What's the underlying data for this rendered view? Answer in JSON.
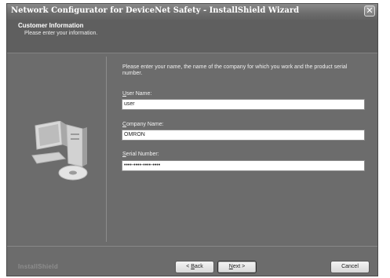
{
  "window": {
    "title": "Network Configurator for DeviceNet Safety - InstallShield Wizard",
    "close_glyph": "✕"
  },
  "header": {
    "title": "Customer Information",
    "subtitle": "Please enter your information."
  },
  "form": {
    "instructions": "Please enter your name, the name of the company for which you work and the product serial number.",
    "user_name": {
      "label_mnemonic": "U",
      "label_rest": "ser Name:",
      "value": "user"
    },
    "company_name": {
      "label_mnemonic": "C",
      "label_rest": "ompany Name:",
      "value": "OMRON"
    },
    "serial_number": {
      "label_mnemonic": "S",
      "label_rest": "erial Number:",
      "value": "••••-••••-••••-••••"
    }
  },
  "footer": {
    "brand": "InstallShield",
    "back": {
      "prefix": "< ",
      "mnemonic": "B",
      "rest": "ack"
    },
    "next": {
      "mnemonic": "N",
      "rest": "ext >"
    },
    "cancel": "Cancel"
  },
  "colors": {
    "header_bg": "#5f5f5f",
    "body_bg": "#6c6c6c",
    "input_bg": "#ffffff"
  },
  "icons": [
    "computer-with-disc-icon",
    "close-icon"
  ]
}
